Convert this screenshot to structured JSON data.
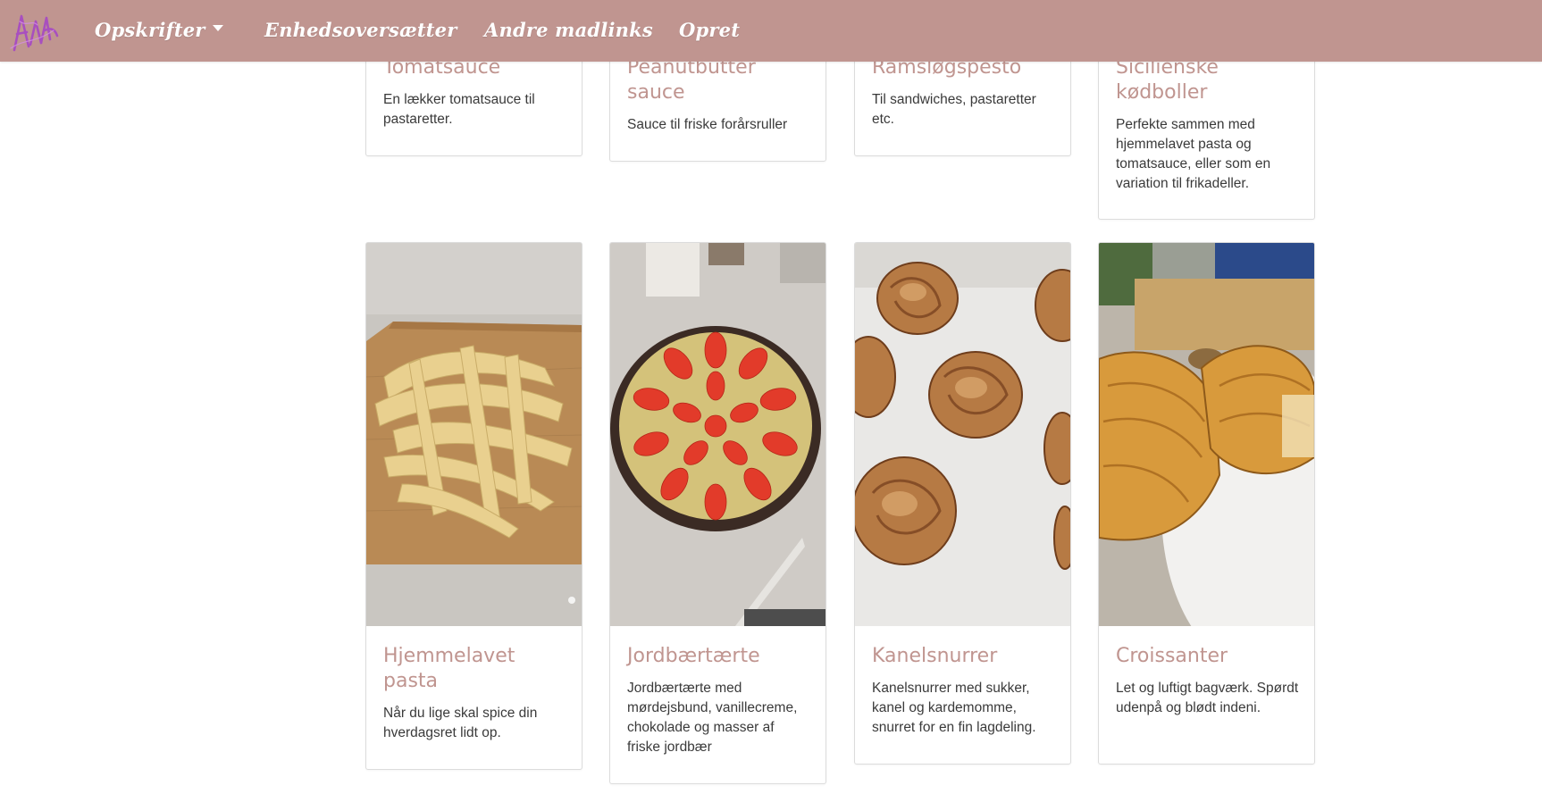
{
  "nav": {
    "items": [
      {
        "label": "Opskrifter",
        "dropdown": true
      },
      {
        "label": "Enhedsoversætter"
      },
      {
        "label": "Andre madlinks"
      },
      {
        "label": "Opret"
      }
    ]
  },
  "recipes": [
    {
      "title": "Tomatsauce",
      "description": "En lækker tomatsauce til pastaretter."
    },
    {
      "title": "Peanutbutter sauce",
      "description": "Sauce til friske forårsruller"
    },
    {
      "title": "Ramsløgspesto",
      "description": "Til sandwiches, pastaretter etc."
    },
    {
      "title": "Sicilienske kødboller",
      "description": "Perfekte sammen med hjemmelavet pasta og tomatsauce, eller som en variation til frikadeller."
    },
    {
      "title": "Hjemmelavet pasta",
      "description": "Når du lige skal spice din hverdagsret lidt op.",
      "image": "fresh-pasta-photo"
    },
    {
      "title": "Jordbærtærte",
      "description": "Jordbærtærte med mørdejsbund, vanillecreme, chokolade og masser af friske jordbær",
      "image": "strawberry-tart-photo"
    },
    {
      "title": "Kanelsnurrer",
      "description": "Kanelsnurrer med sukker, kanel og kardemomme, snurret for en fin lagdeling.",
      "image": "cinnamon-buns-photo"
    },
    {
      "title": "Croissanter",
      "description": "Let og luftigt bagværk. Spørdt udenpå og blødt indeni.",
      "image": "croissants-photo"
    }
  ],
  "colors": {
    "navbar": "#c09590",
    "title": "#c09590",
    "text": "#3a3a3a",
    "border": "#dcdcdc"
  }
}
